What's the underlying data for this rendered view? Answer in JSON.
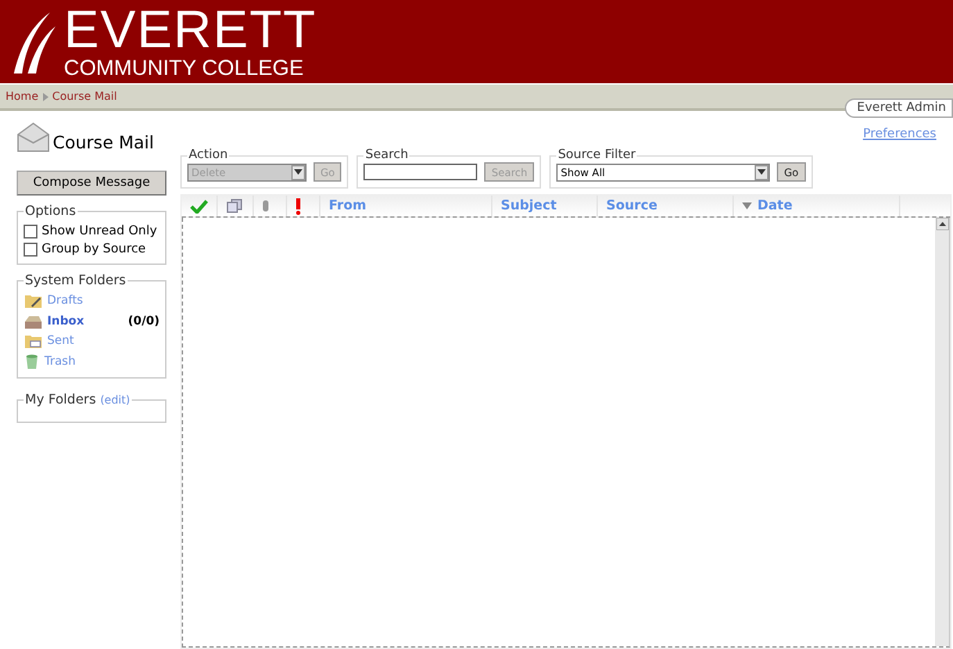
{
  "header": {
    "title": "EVERETT",
    "subtitle": "COMMUNITY COLLEGE"
  },
  "breadcrumb": [
    "Home",
    "Course Mail"
  ],
  "user": "Everett Admin",
  "preferences": "Preferences",
  "page_title": "Course Mail",
  "compose_button": "Compose Message",
  "options": {
    "legend": "Options",
    "items": [
      {
        "label": "Show Unread Only",
        "checked": false
      },
      {
        "label": "Group by Source",
        "checked": false
      }
    ]
  },
  "system_folders": {
    "legend": "System Folders",
    "items": [
      {
        "kind": "drafts",
        "name": "Drafts",
        "selected": false
      },
      {
        "kind": "inbox",
        "name": "Inbox",
        "count": "(0/0)",
        "selected": true
      },
      {
        "kind": "sent",
        "name": "Sent",
        "selected": false
      },
      {
        "kind": "trash",
        "name": "Trash",
        "selected": false
      }
    ]
  },
  "my_folders": {
    "legend": "My Folders",
    "edit": "(edit)"
  },
  "action": {
    "legend": "Action",
    "value": "Delete",
    "disabled": true,
    "go": "Go"
  },
  "search": {
    "legend": "Search",
    "button": "Search",
    "disabled": true
  },
  "source_filter": {
    "legend": "Source Filter",
    "value": "Show All",
    "go": "Go"
  },
  "columns": [
    {
      "kind": "read"
    },
    {
      "kind": "copy"
    },
    {
      "kind": "attach"
    },
    {
      "kind": "priority"
    },
    {
      "kind": "text",
      "label": "From",
      "sorted": false
    },
    {
      "kind": "text",
      "label": "Subject",
      "sorted": false
    },
    {
      "kind": "text",
      "label": "Source",
      "sorted": false
    },
    {
      "kind": "text",
      "label": "Date",
      "sorted": true
    }
  ]
}
